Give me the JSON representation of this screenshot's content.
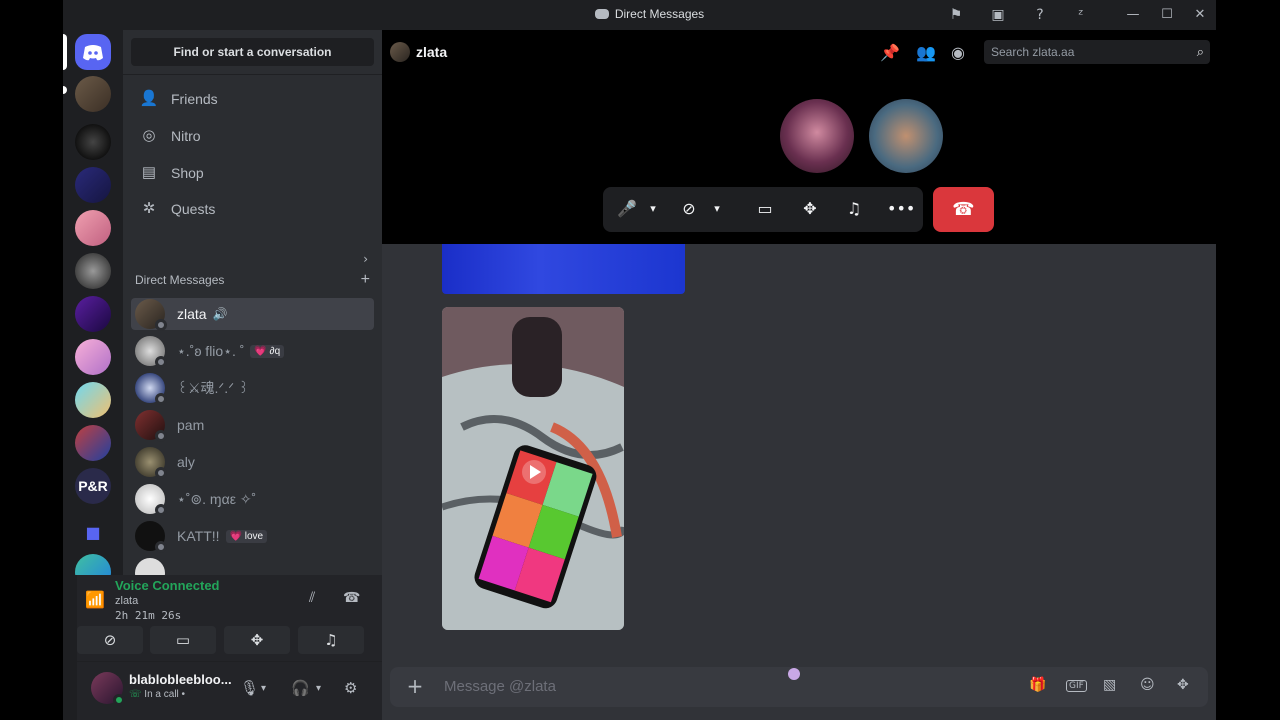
{
  "window": {
    "title": "Direct Messages"
  },
  "sidebar": {
    "find_button": "Find or start a conversation",
    "nav": [
      {
        "label": "Friends",
        "icon": "friends-icon"
      },
      {
        "label": "Nitro",
        "icon": "nitro-icon"
      },
      {
        "label": "Shop",
        "icon": "shop-icon"
      },
      {
        "label": "Quests",
        "icon": "quests-icon"
      }
    ],
    "dm_header": "Direct Messages",
    "dms": [
      {
        "name": "zlata",
        "active": true,
        "speaker": "🔊"
      },
      {
        "name": "⋆.˚ʚ flio⋆. ˚",
        "badge": "💗 ∂q"
      },
      {
        "name": "꒰⚔魂.ᐟ.ᐟ ꒱"
      },
      {
        "name": "pam"
      },
      {
        "name": "aly"
      },
      {
        "name": "⋆˚⊚. ɱαε ✧˚"
      },
      {
        "name": "KATT!!",
        "badge": "💗 love"
      }
    ]
  },
  "voice": {
    "status": "Voice Connected",
    "channel": "zlata",
    "elapsed": "2h 21m 26s"
  },
  "user": {
    "name": "blablobleebloo...",
    "status": "In a call •"
  },
  "chat": {
    "recipient": "zlata",
    "search_placeholder": "Search zlata.aa",
    "composer_placeholder": "Message @zlata"
  },
  "colors": {
    "background": "#313338",
    "sidebar": "#2b2d31",
    "hangup": "#da373c",
    "online": "#23a55a",
    "blurple": "#5865f2"
  }
}
